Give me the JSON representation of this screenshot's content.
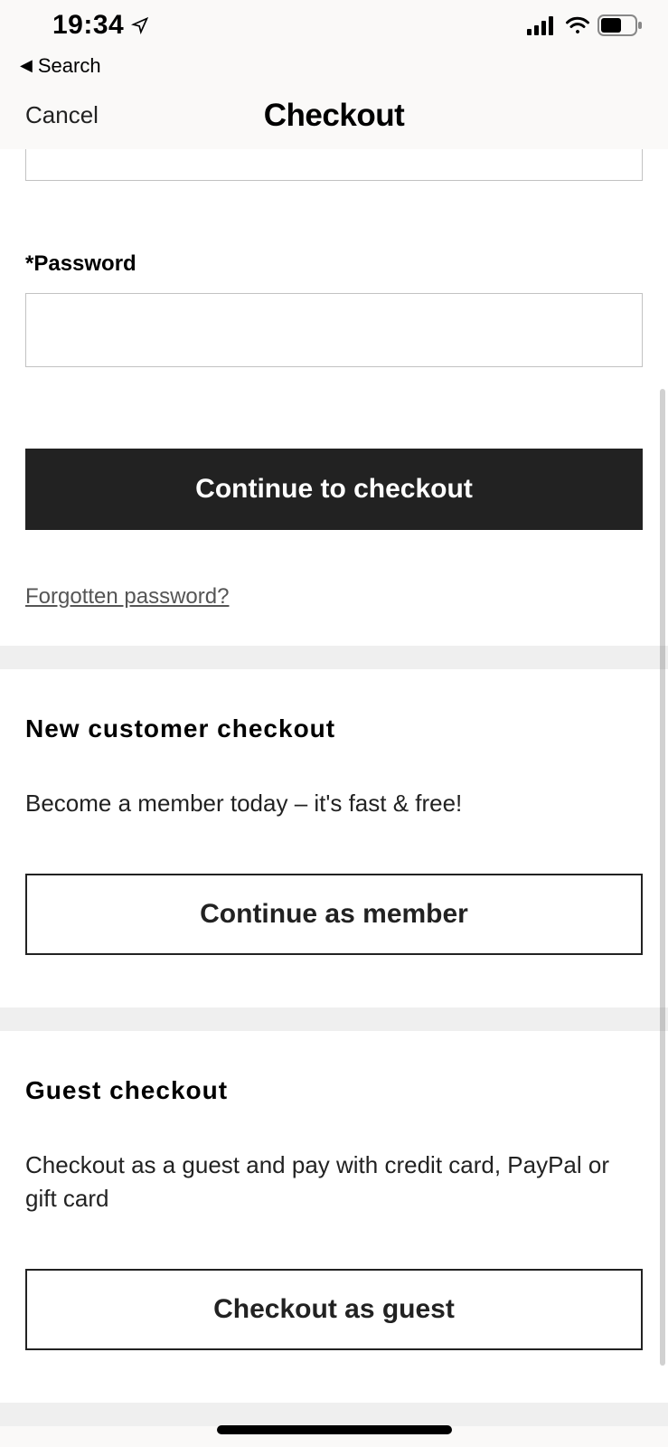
{
  "status_bar": {
    "time": "19:34"
  },
  "back_search": {
    "label": "Search"
  },
  "nav": {
    "cancel": "Cancel",
    "title": "Checkout"
  },
  "login": {
    "password_label": "*Password",
    "continue_button": "Continue to checkout",
    "forgot_link": "Forgotten password?"
  },
  "new_customer": {
    "title": "New customer checkout",
    "desc": "Become a member today – it's fast & free!",
    "button": "Continue as member"
  },
  "guest": {
    "title": "Guest checkout",
    "desc": "Checkout as a guest and pay with credit card, PayPal or gift card",
    "button": "Checkout as guest"
  }
}
